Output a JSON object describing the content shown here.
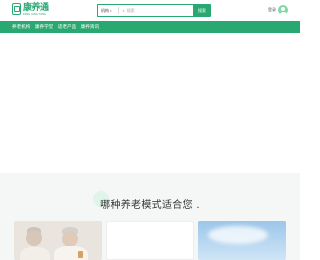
{
  "header": {
    "logo": {
      "name": "康养通",
      "subtitle": "KANG YANG TONG"
    },
    "search": {
      "scope": "机构",
      "placeholder": "搜索",
      "button_label": "搜索"
    },
    "login": {
      "label": "登录"
    }
  },
  "nav": {
    "items": [
      {
        "label": "养老机构"
      },
      {
        "label": "康养学堂"
      },
      {
        "label": "适老产品"
      },
      {
        "label": "康养资讯"
      }
    ]
  },
  "section": {
    "title": "哪种养老模式适合您 ."
  },
  "colors": {
    "brand": "#2aa872",
    "section_bg": "#f4f7f6"
  }
}
